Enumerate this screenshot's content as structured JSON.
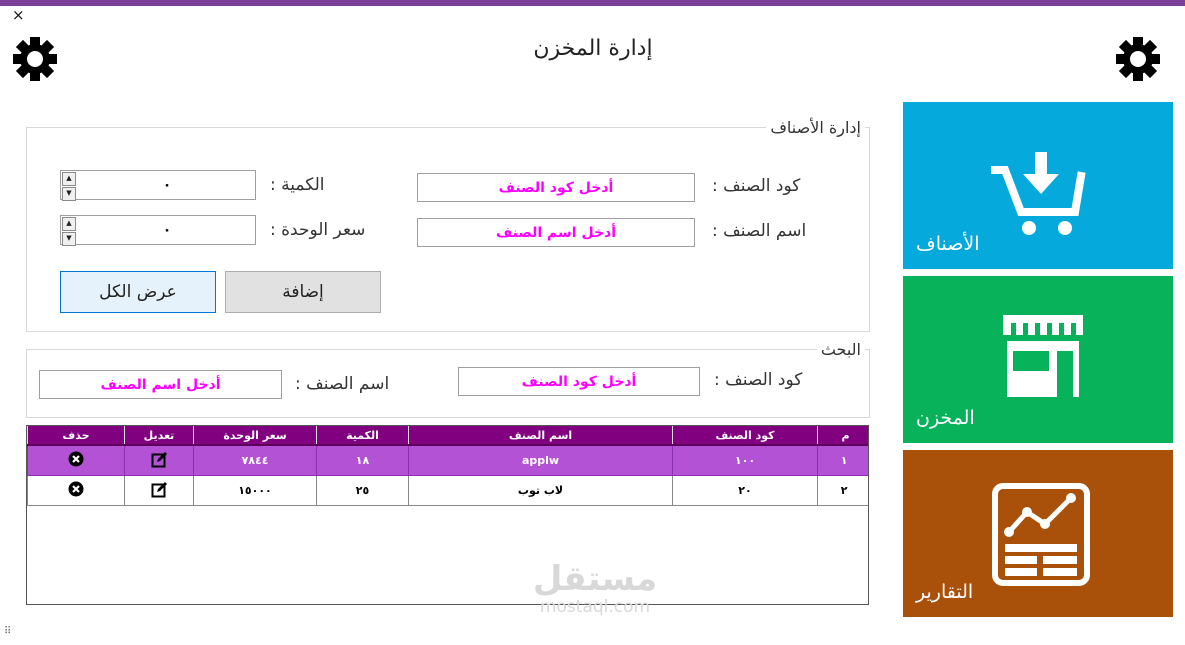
{
  "window": {
    "title": "إدارة المخزن",
    "close_glyph": "×",
    "accent_color": "#7b3f98"
  },
  "icons": {
    "left_settings": "gear-icon",
    "right_settings": "gear-icon"
  },
  "tiles": [
    {
      "label": "الأصناف",
      "icon": "cart-download-icon",
      "color": "#05a9dc"
    },
    {
      "label": "المخزن",
      "icon": "store-icon",
      "color": "#07b25b"
    },
    {
      "label": "التقارير",
      "icon": "report-chart-icon",
      "color": "#a9510a"
    }
  ],
  "items_group": {
    "legend": "إدارة الأصناف",
    "code_label": "كود الصنف :",
    "code_placeholder": "أدخل كود الصنف",
    "name_label": "اسم الصنف :",
    "name_placeholder": "أدخل اسم الصنف",
    "qty_label": "الكمية :",
    "qty_value": "٠",
    "price_label": "سعر الوحدة :",
    "price_value": "٠",
    "add_button": "إضافة",
    "show_all_button": "عرض الكل"
  },
  "search_group": {
    "legend": "البحث",
    "code_label": "كود الصنف :",
    "code_placeholder": "أدخل كود الصنف",
    "name_label": "اسم الصنف :",
    "name_placeholder": "أدخل اسم الصنف"
  },
  "table": {
    "headers": [
      "م",
      "كود الصنف",
      "اسم الصنف",
      "الكمية",
      "سعر الوحدة",
      "تعديل",
      "حذف"
    ],
    "rows": [
      {
        "index": "١",
        "code": "١٠٠",
        "name": "applw",
        "qty": "١٨",
        "price": "٧٨٤٤",
        "selected": true
      },
      {
        "index": "٢",
        "code": "٢٠",
        "name": "لاب توب",
        "qty": "٢٥",
        "price": "١٥٠٠٠",
        "selected": false
      }
    ],
    "edit_icon": "edit-icon",
    "delete_icon": "delete-icon",
    "selected_color": "#b452d6",
    "header_color": "#800080"
  },
  "watermark": {
    "arabic": "مستقل",
    "latin": "mostaql.com"
  },
  "resize_grip": "⠿"
}
